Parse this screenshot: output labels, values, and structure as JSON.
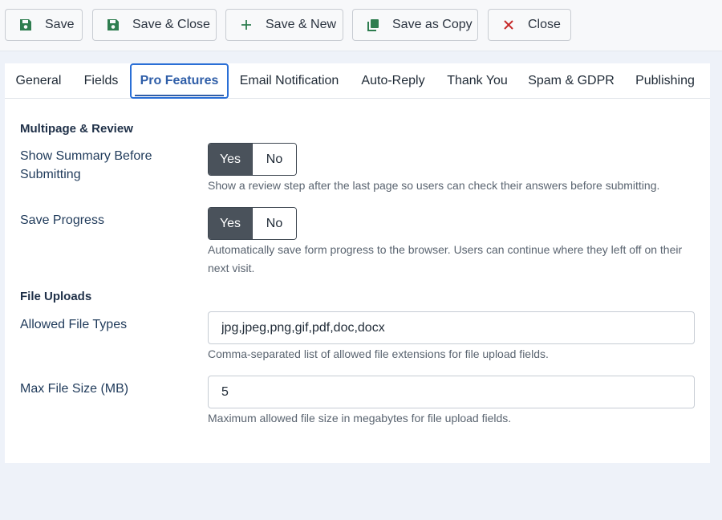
{
  "toolbar": {
    "save": "Save",
    "save_close": "Save & Close",
    "save_new": "Save & New",
    "save_copy": "Save as Copy",
    "close": "Close",
    "icons": {
      "save": "floppy-disk-icon",
      "save_new": "plus-icon",
      "save_copy": "copy-icon",
      "close": "x-icon"
    },
    "colors": {
      "save_icon": "#2e7d4f",
      "close_icon": "#c62828",
      "copy_icon": "#2e7d4f"
    }
  },
  "tabs": [
    {
      "label": "General"
    },
    {
      "label": "Fields"
    },
    {
      "label": "Pro Features",
      "active": true
    },
    {
      "label": "Email Notification"
    },
    {
      "label": "Auto-Reply"
    },
    {
      "label": "Thank You"
    },
    {
      "label": "Spam & GDPR"
    },
    {
      "label": "Publishing"
    }
  ],
  "sections": {
    "multipage": {
      "heading": "Multipage & Review",
      "summary": {
        "label": "Show Summary Before Submitting",
        "yes": "Yes",
        "no": "No",
        "value": "Yes",
        "help": "Show a review step after the last page so users can check their answers before submitting."
      },
      "progress": {
        "label": "Save Progress",
        "yes": "Yes",
        "no": "No",
        "value": "Yes",
        "help": "Automatically save form progress to the browser. Users can continue where they left off on their next visit."
      }
    },
    "uploads": {
      "heading": "File Uploads",
      "types": {
        "label": "Allowed File Types",
        "value": "jpg,jpeg,png,gif,pdf,doc,docx",
        "help": "Comma-separated list of allowed file extensions for file upload fields."
      },
      "size": {
        "label": "Max File Size (MB)",
        "value": "5",
        "help": "Maximum allowed file size in megabytes for file upload fields."
      }
    }
  },
  "colors": {
    "active_tab": "#2f5ea8",
    "toggle_on": "#4a525b",
    "page_bg": "#eef2f9"
  }
}
